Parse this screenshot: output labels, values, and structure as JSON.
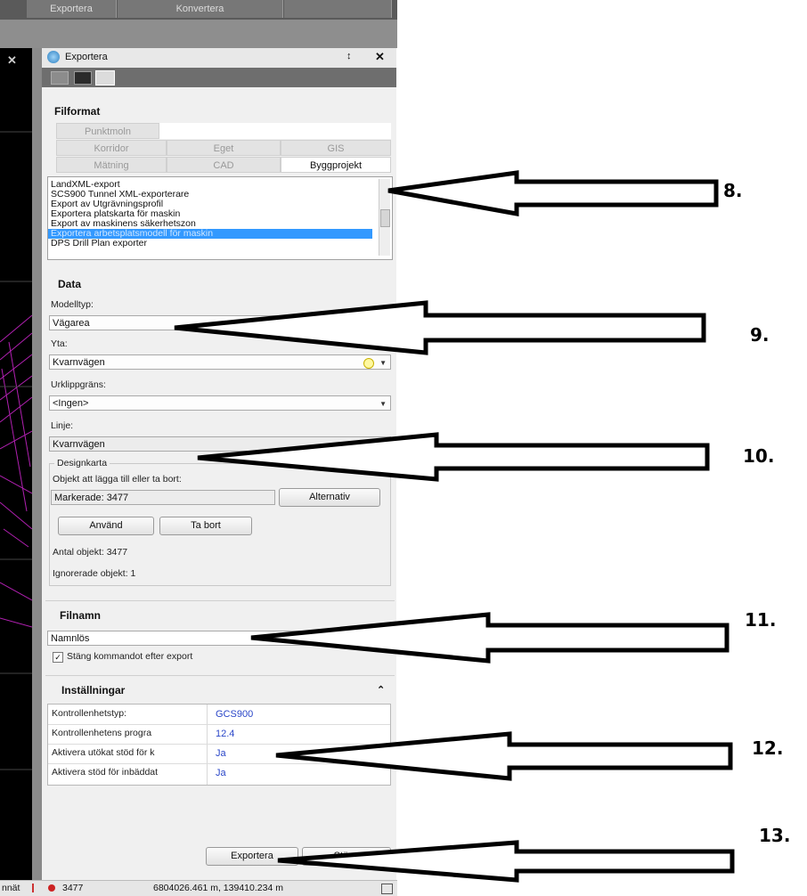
{
  "app": {
    "top_tabs": [
      "Exportera",
      "Konvertera",
      ""
    ]
  },
  "panel": {
    "title": "Exportera",
    "pin_glyph": "↕",
    "close_glyph": "✕",
    "fileformat": {
      "heading": "Filformat",
      "punktmoln_tab": "Punktmoln",
      "row1": [
        "Korridor",
        "Eget",
        "GIS"
      ],
      "row2": [
        "Mätning",
        "CAD",
        "Byggprojekt"
      ],
      "active_tab": "Byggprojekt",
      "formats": [
        "LandXML-export",
        "SCS900 Tunnel XML-exporterare",
        "Export av Utgrävningsprofil",
        "Exportera platskarta för maskin",
        "Export av maskinens säkerhetszon",
        "Exportera arbetsplatsmodell för maskin",
        "DPS Drill Plan exporter"
      ],
      "selected_index": 5
    },
    "data": {
      "heading": "Data",
      "modelltyp_label": "Modelltyp:",
      "modelltyp_value": "Vägarea",
      "yta_label": "Yta:",
      "yta_value": "Kvarnvägen",
      "urklipp_label": "Urklippgräns:",
      "urklipp_value": "<Ingen>",
      "linje_label": "Linje:",
      "linje_value": "Kvarnvägen",
      "designkarta": {
        "legend": "Designkarta",
        "objekt_label": "Objekt att lägga till eller ta bort:",
        "markerade": "Markerade: 3477",
        "alternativ_btn": "Alternativ",
        "anvand_btn": "Använd",
        "tabort_btn": "Ta bort",
        "antal": "Antal objekt: 3477",
        "ignorerade": "Ignorerade objekt: 1"
      }
    },
    "filnamn": {
      "heading": "Filnamn",
      "value": "Namnlös",
      "checkbox_label": "Stäng kommandot efter export",
      "checked": true
    },
    "installningar": {
      "heading": "Inställningar",
      "collapse_glyph": "⌃",
      "rows": [
        {
          "key": "Kontrollenhetstyp:",
          "value": "GCS900"
        },
        {
          "key": "Kontrollenhetens progra",
          "value": "12.4"
        },
        {
          "key": "Aktivera utökat stöd för k",
          "value": "Ja"
        },
        {
          "key": "Aktivera stöd för inbäddat",
          "value": "Ja"
        }
      ]
    },
    "footer": {
      "exportera_btn": "Exportera",
      "stang_btn": "Stäng"
    }
  },
  "statusbar": {
    "left_text": "nnät",
    "count": "3477",
    "coords": "6804026.461 m, 139410.234 m"
  },
  "annotations": [
    "8.",
    "9.",
    "10.",
    "11.",
    "12.",
    "13."
  ]
}
